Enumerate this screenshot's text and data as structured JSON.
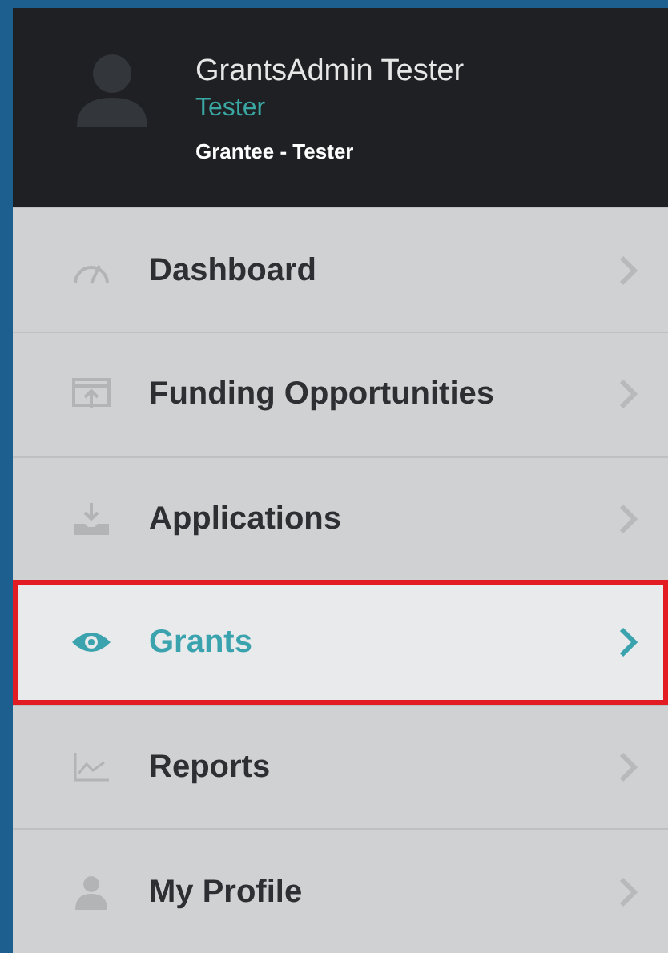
{
  "user": {
    "name": "GrantsAdmin Tester",
    "role": "Tester",
    "organization": "Grantee - Tester"
  },
  "menu": [
    {
      "label": "Dashboard",
      "selected": false
    },
    {
      "label": "Funding Opportunities",
      "selected": false
    },
    {
      "label": "Applications",
      "selected": false
    },
    {
      "label": "Grants",
      "selected": true
    },
    {
      "label": "Reports",
      "selected": false
    },
    {
      "label": "My Profile",
      "selected": false
    }
  ]
}
